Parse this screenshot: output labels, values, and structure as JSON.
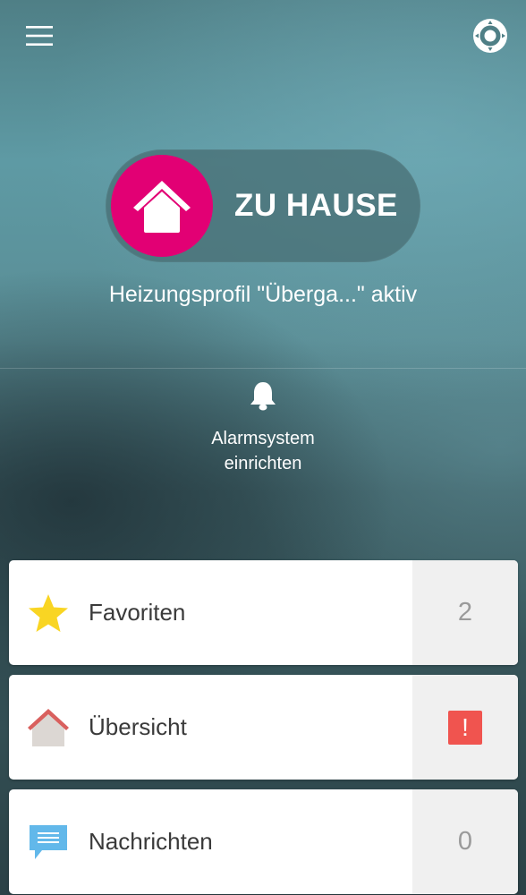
{
  "header": {
    "menu_icon": "hamburger-menu-icon",
    "remote_icon": "remote-control-icon"
  },
  "mode": {
    "label": "ZU HAUSE",
    "icon": "house-icon",
    "accent_color": "#e20074"
  },
  "status": {
    "text": "Heizungsprofil \"Überga...\" aktiv"
  },
  "alarm": {
    "icon": "bell-icon",
    "line1": "Alarmsystem",
    "line2": "einrichten"
  },
  "cards": {
    "favorites": {
      "label": "Favoriten",
      "icon": "star-icon",
      "count": "2"
    },
    "overview": {
      "label": "Übersicht",
      "icon": "house-icon",
      "badge": "!",
      "badge_color": "#f0544f"
    },
    "messages": {
      "label": "Nachrichten",
      "icon": "chat-bubble-icon",
      "count": "0"
    }
  }
}
